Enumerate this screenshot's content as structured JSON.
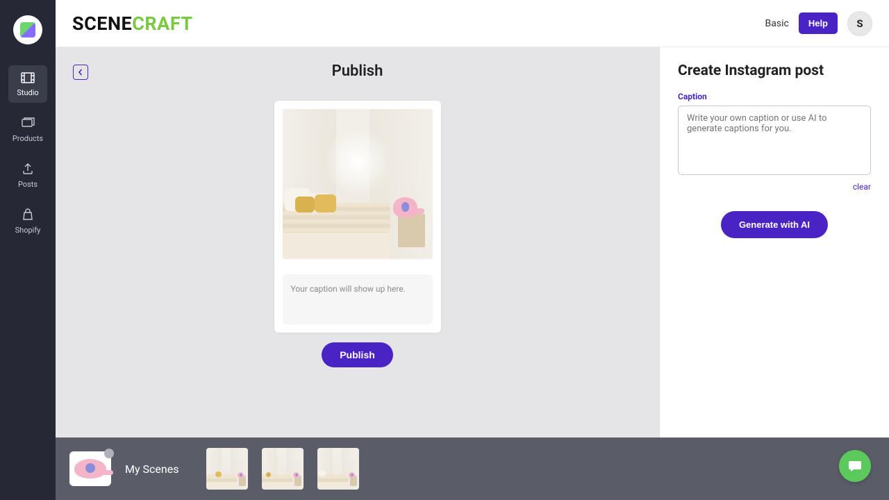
{
  "brand": {
    "part1": "SCENE",
    "part2": "CRAFT"
  },
  "header": {
    "plan": "Basic",
    "help_label": "Help",
    "avatar_initial": "S"
  },
  "sidebar": {
    "items": [
      {
        "label": "Studio"
      },
      {
        "label": "Products"
      },
      {
        "label": "Posts"
      },
      {
        "label": "Shopify"
      }
    ]
  },
  "preview": {
    "title": "Publish",
    "caption_placeholder": "Your caption will show up here.",
    "publish_label": "Publish"
  },
  "panel": {
    "title": "Create Instagram post",
    "caption_label": "Caption",
    "caption_placeholder": "Write your own caption or use AI to generate captions for you.",
    "clear_label": "clear",
    "generate_label": "Generate with AI"
  },
  "scenes": {
    "label": "My Scenes",
    "thumb_count": 3
  },
  "colors": {
    "accent": "#4a23c5",
    "brand_green": "#7ac943"
  }
}
